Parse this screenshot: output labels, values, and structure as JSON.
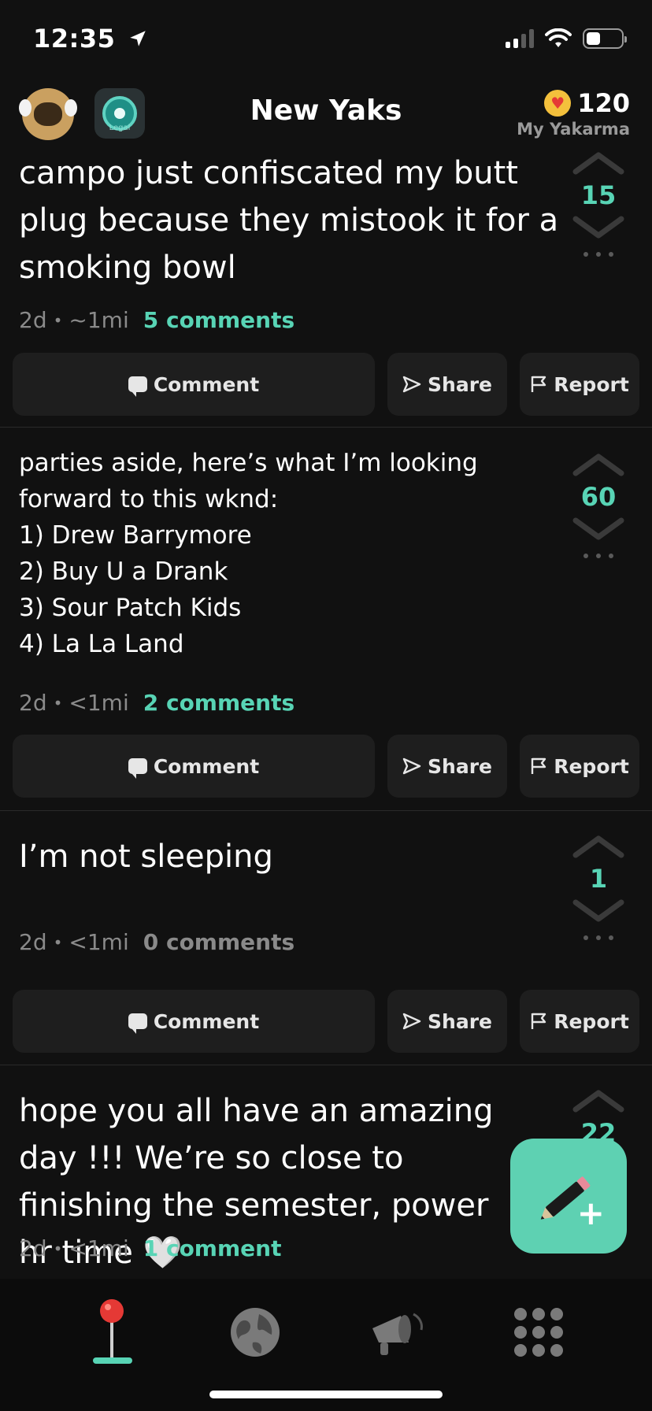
{
  "status_bar": {
    "time": "12:35"
  },
  "header": {
    "title": "New Yaks",
    "badge_text": "Legal",
    "yakarma_count": "120",
    "yakarma_label": "My Yakarma"
  },
  "posts": [
    {
      "text": "campo just confiscated my butt plug because they mistook it for a smoking bowl",
      "votes": "15",
      "age": "2d",
      "distance": "~1mi",
      "comments": "5 comments"
    },
    {
      "text": "parties aside, here’s what I’m looking forward to this wknd:\n1) Drew Barrymore\n2) Buy U a Drank\n3) Sour Patch Kids\n4) La La Land",
      "votes": "60",
      "age": "2d",
      "distance": "<1mi",
      "comments": "2 comments"
    },
    {
      "text": "I’m not sleeping",
      "votes": "1",
      "age": "2d",
      "distance": "<1mi",
      "comments": "0 comments"
    },
    {
      "text": "hope you all have an amazing day !!! We’re so close to finishing the semester, power hr time 🤍",
      "votes": "22",
      "age": "2d",
      "distance": "<1mi",
      "comments": "1 comment"
    }
  ],
  "actions": {
    "comment": "Comment",
    "share": "Share",
    "report": "Report"
  },
  "meta_separator": "•",
  "nav": {
    "active": "home"
  },
  "colors": {
    "accent": "#58d4b5",
    "background": "#111111",
    "button": "#1e1e1e",
    "fab": "#5ed1b2"
  },
  "icons": [
    "location-arrow-icon",
    "signal-icon",
    "wifi-icon",
    "battery-icon",
    "yak-avatar-icon",
    "legal-badge-icon",
    "heart-coin-icon",
    "upvote-icon",
    "downvote-icon",
    "more-icon",
    "comment-icon",
    "share-icon",
    "report-flag-icon",
    "pencil-plus-icon",
    "pin-icon",
    "globe-icon",
    "megaphone-icon",
    "grid-icon"
  ]
}
